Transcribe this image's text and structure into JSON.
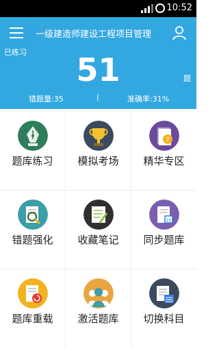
{
  "status_bar": {
    "time": "10:52"
  },
  "header": {
    "title": "一级建造师建设工程项目管理",
    "practiced_label": "已练习",
    "count": "51",
    "unit": "题",
    "wrong_count": "错题量:35",
    "separator": "|",
    "accuracy": "准确率:31%"
  },
  "grid": {
    "items": [
      {
        "label": "题库练习",
        "icon": "pen-nib-icon"
      },
      {
        "label": "模拟考场",
        "icon": "trophy-icon"
      },
      {
        "label": "精华专区",
        "icon": "question-book-icon"
      },
      {
        "label": "错题强化",
        "icon": "magnifier-doc-icon"
      },
      {
        "label": "收藏笔记",
        "icon": "notebook-pencil-icon"
      },
      {
        "label": "同步题库",
        "icon": "calendar-doc-icon"
      },
      {
        "label": "题库重载",
        "icon": "reload-doc-icon"
      },
      {
        "label": "激活题库",
        "icon": "people-icon"
      },
      {
        "label": "切换科目",
        "icon": "switch-doc-icon"
      }
    ]
  },
  "colors": {
    "header_bg": "#33a8e0",
    "text": "#222222"
  }
}
